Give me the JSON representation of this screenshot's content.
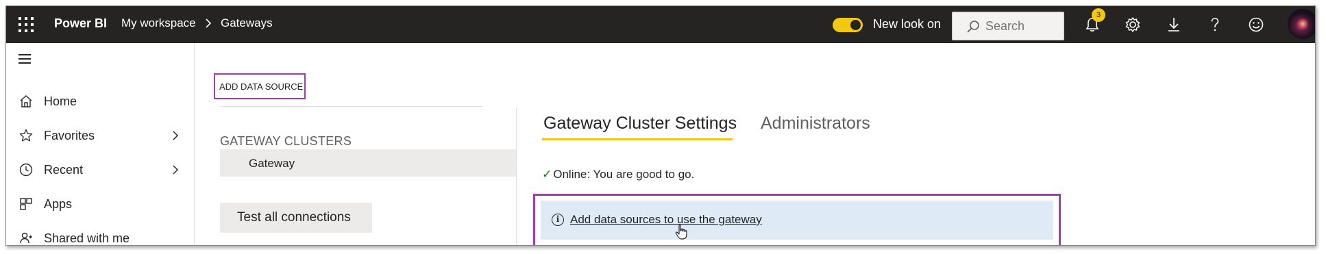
{
  "colors": {
    "accent_yellow": "#f2c811",
    "highlight_purple": "#a33bb0",
    "info_background": "#deebf7",
    "topbar": "#252423"
  },
  "header": {
    "app_name": "Power BI",
    "breadcrumb": [
      "My workspace",
      "Gateways"
    ],
    "toggle_label": "New look on",
    "toggle_on": true,
    "search_placeholder": "Search",
    "notification_count": "3",
    "icons": [
      "app-launcher-icon",
      "bell-icon",
      "gear-icon",
      "download-icon",
      "help-icon",
      "smiley-icon"
    ]
  },
  "sidebar": {
    "items": [
      {
        "label": "Home",
        "icon": "home-icon",
        "has_chevron": false
      },
      {
        "label": "Favorites",
        "icon": "star-icon",
        "has_chevron": true
      },
      {
        "label": "Recent",
        "icon": "clock-icon",
        "has_chevron": true
      },
      {
        "label": "Apps",
        "icon": "apps-icon",
        "has_chevron": false
      },
      {
        "label": "Shared with me",
        "icon": "shared-icon",
        "has_chevron": false
      }
    ]
  },
  "gateways": {
    "add_source_label": "ADD DATA SOURCE",
    "clusters_title": "GATEWAY CLUSTERS",
    "cluster_name": "Gateway",
    "test_button_label": "Test all connections"
  },
  "detail": {
    "tabs": [
      {
        "label": "Gateway Cluster Settings",
        "active": true
      },
      {
        "label": "Administrators",
        "active": false
      }
    ],
    "status_text": "Online: You are good to go.",
    "info_link": "Add data sources to use the gateway"
  }
}
